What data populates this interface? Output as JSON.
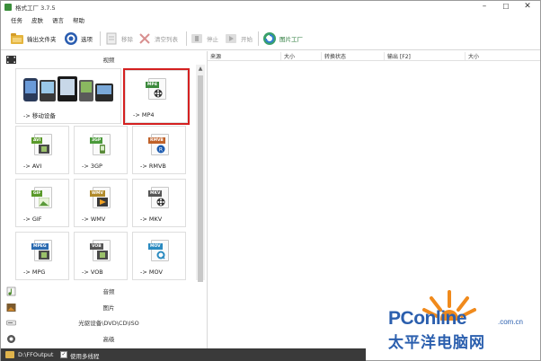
{
  "window": {
    "title": "格式工厂 3.7.5"
  },
  "menu": [
    "任务",
    "皮肤",
    "语言",
    "帮助"
  ],
  "toolbar": {
    "output_folder": "输出文件夹",
    "options": "选项",
    "remove": "移除",
    "clear_list": "清空列表",
    "stop": "停止",
    "start": "开始",
    "shop": "图片工厂"
  },
  "left": {
    "video_category": "视频",
    "tiles": [
      {
        "label": "-> 移动设备",
        "icon": "mobile-devices-icon"
      },
      {
        "label": "-> MP4",
        "tag": "MP4",
        "tag_color": "#3d8a3d",
        "icon": "film-reel-icon"
      },
      {
        "label": "-> AVI",
        "tag": "AVI",
        "tag_color": "#5a9a2a",
        "icon": "film-strip-icon"
      },
      {
        "label": "-> 3GP",
        "tag": "3GP",
        "tag_color": "#4a9a3a",
        "icon": "phone-icon"
      },
      {
        "label": "-> RMVB",
        "tag": "RMVB",
        "tag_color": "#c0622a",
        "icon": "real-icon"
      },
      {
        "label": "-> GIF",
        "tag": "GIF",
        "tag_color": "#5a9a2a",
        "icon": "image-icon"
      },
      {
        "label": "-> WMV",
        "tag": "WMV",
        "tag_color": "#b08a2a",
        "icon": "windows-media-icon"
      },
      {
        "label": "-> MKV",
        "tag": "MKV",
        "tag_color": "#555555",
        "icon": "film-reel-icon"
      },
      {
        "label": "-> MPG",
        "tag": "MPEG",
        "tag_color": "#2a6ab0",
        "icon": "film-strip-icon"
      },
      {
        "label": "-> VOB",
        "tag": "VOB",
        "tag_color": "#555555",
        "icon": "film-strip-icon"
      },
      {
        "label": "-> MOV",
        "tag": "MOV",
        "tag_color": "#2a8ac0",
        "icon": "quicktime-icon"
      }
    ],
    "audio_category": "音频",
    "image_category": "图片",
    "rom_category": "光驱设备\\DVD\\CD\\ISO",
    "advanced_category": "高级"
  },
  "list": {
    "columns": [
      "来源",
      "大小",
      "转换状态",
      "输出 [F2]",
      "大小"
    ]
  },
  "watermark": {
    "brand_p": "PC",
    "brand_rest": "online",
    "domain": ".com.cn",
    "cn": "太平洋电脑网"
  },
  "status": {
    "path": "D:\\FFOutput",
    "multithread": "使用多线程"
  }
}
